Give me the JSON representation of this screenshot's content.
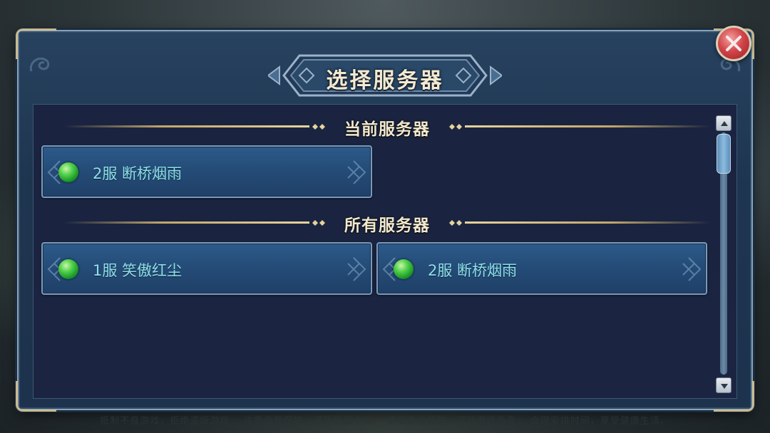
{
  "dialog": {
    "title": "选择服务器",
    "close_icon": "close-x-icon"
  },
  "current_section": {
    "label": "当前服务器",
    "servers": [
      {
        "name": "2服  断桥烟雨",
        "status": "online",
        "status_color": "#3fc843"
      }
    ]
  },
  "all_section": {
    "label": "所有服务器",
    "servers": [
      {
        "name": "1服  笑傲红尘",
        "status": "online",
        "status_color": "#3fc843"
      },
      {
        "name": "2服  断桥烟雨",
        "status": "online",
        "status_color": "#3fc843"
      }
    ]
  },
  "scrollbar": {
    "up_icon": "arrow-up-icon",
    "down_icon": "arrow-down-icon"
  },
  "footer": {
    "notice": "抵制不良游戏，拒绝盗版游戏。  注意自我保护，谨防受骗上当。  适度游戏益脑，沉迷游戏伤身。  合理安排时间，享受健康生活。"
  },
  "colors": {
    "panel": "#1e3550",
    "gold_accent": "#c2a66a",
    "server_text": "#8de0ea",
    "close_button": "#d2464a"
  }
}
